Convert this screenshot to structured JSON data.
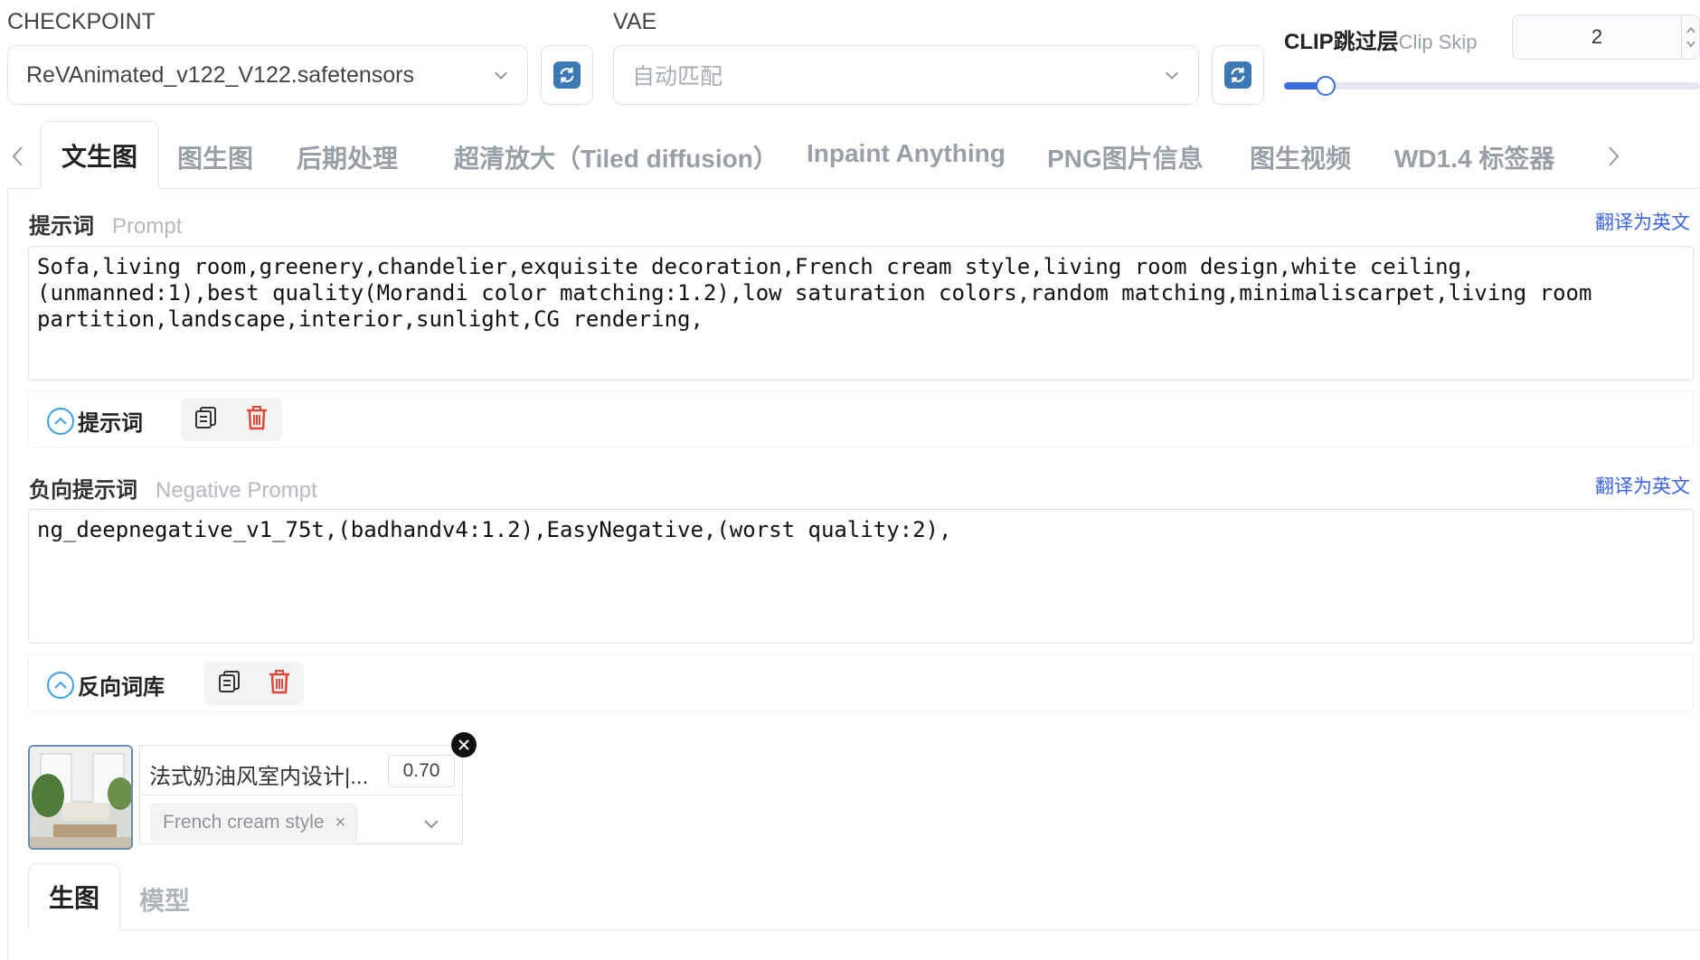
{
  "checkpoint": {
    "label": "CHECKPOINT",
    "value": "ReVAnimated_v122_V122.safetensors"
  },
  "vae": {
    "label": "VAE",
    "placeholder": "自动匹配"
  },
  "clip_skip": {
    "label": "CLIP跳过层",
    "sublabel": "Clip Skip",
    "value": "2",
    "slider_fraction": 0.1
  },
  "tabs": [
    {
      "label": "文生图",
      "active": true
    },
    {
      "label": "图生图"
    },
    {
      "label": "后期处理"
    },
    {
      "label": "超清放大（Tiled diffusion）"
    },
    {
      "label": "Inpaint Anything"
    },
    {
      "label": "PNG图片信息"
    },
    {
      "label": "图生视频"
    },
    {
      "label": "WD1.4 标签器"
    }
  ],
  "prompt": {
    "title": "提示词",
    "subtitle": "Prompt",
    "translate": "翻译为英文",
    "text": "Sofa,living room,greenery,chandelier,exquisite decoration,French cream style,living room design,white ceiling,\n(unmanned:1),best quality(Morandi color matching:1.2),low saturation colors,random matching,minimaliscarpet,living room\npartition,landscape,interior,sunlight,CG rendering,",
    "collapse_label": "提示词"
  },
  "negative": {
    "title": "负向提示词",
    "subtitle": "Negative Prompt",
    "translate": "翻译为英文",
    "text": "ng_deepnegative_v1_75t,(badhandv4:1.2),EasyNegative,(worst quality:2),",
    "collapse_label": "反向词库"
  },
  "lora": {
    "name": "法式奶油风室内设计|...",
    "weight": "0.70",
    "tag": "French cream style",
    "tag_remove": "×"
  },
  "bottom_tabs": [
    {
      "label": "生图",
      "active": true
    },
    {
      "label": "模型"
    }
  ],
  "colors": {
    "accent": "#3b6fe0",
    "link": "#3a62e6",
    "delete": "#e0463a",
    "refresh": "#3c78b4"
  }
}
